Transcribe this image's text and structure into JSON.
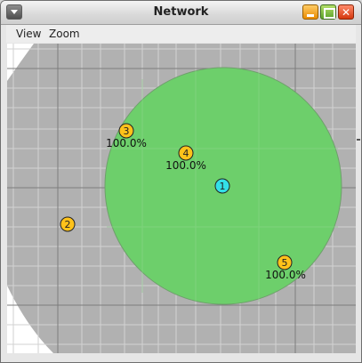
{
  "window": {
    "title": "Network"
  },
  "menu": {
    "items": [
      {
        "label": "View"
      },
      {
        "label": "Zoom"
      }
    ]
  },
  "network": {
    "coverage_color": "#6dcf6b",
    "background_color": "#b1b1b1",
    "nodes": [
      {
        "id": "1",
        "color": "#33e0e8",
        "label": ""
      },
      {
        "id": "2",
        "color": "#ffc21a",
        "label": ""
      },
      {
        "id": "3",
        "color": "#ffc21a",
        "label": "100.0%"
      },
      {
        "id": "4",
        "color": "#ffc21a",
        "label": "100.0%"
      },
      {
        "id": "5",
        "color": "#ffc21a",
        "label": "100.0%"
      }
    ]
  }
}
